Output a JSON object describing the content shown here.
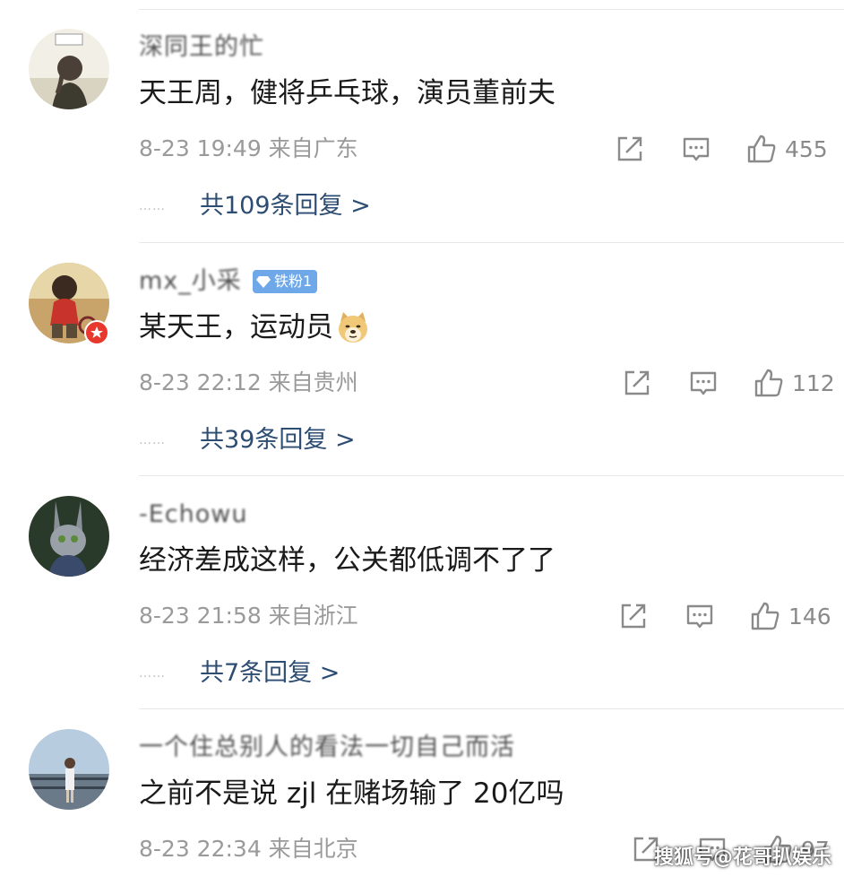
{
  "comments": [
    {
      "username": "深同王的忙",
      "text": "天王周，健将乒乓球，演员董前夫",
      "time_location": "8-23 19:49 来自广东",
      "likes": "455",
      "replies": "共109条回复 >"
    },
    {
      "username": "mx_小采",
      "fan_badge": "铁粉1",
      "text": "某天王，运动员",
      "time_location": "8-23 22:12 来自贵州",
      "likes": "112",
      "replies": "共39条回复 >"
    },
    {
      "username": "-Echowu",
      "text": "经济差成这样，公关都低调不了了",
      "time_location": "8-23 21:58 来自浙江",
      "likes": "146",
      "replies": "共7条回复 >"
    },
    {
      "username": "一个住总别人的看法一切自己而活",
      "text": "之前不是说 zjl 在赌场输了 20亿吗",
      "time_location": "8-23 22:34 来自北京",
      "likes": "97"
    }
  ],
  "replies_dots": "……",
  "watermark": "搜狐号@花哥扒娱乐",
  "colors": {
    "reply_link": "#2d4d72",
    "meta_gray": "#9a9a9a",
    "fan_badge": "#6fa8e8",
    "avatar_badge": "#e8372c"
  },
  "icons": {
    "repost": "repost-icon",
    "comment": "comment-icon",
    "like": "thumbs-up-icon",
    "fan": "diamond-icon",
    "emoji": "doge-emoji"
  }
}
